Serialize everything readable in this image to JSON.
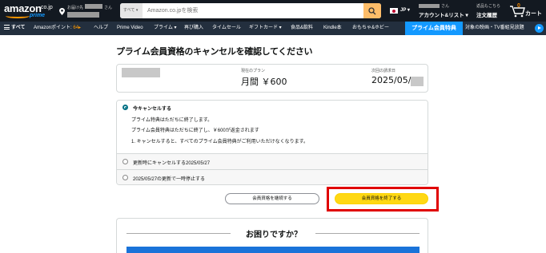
{
  "header": {
    "logo_text": "amazon",
    "logo_tld": ".co.jp",
    "logo_prime": "prime",
    "deliver_label": "お届け先",
    "deliver_suffix": "さん",
    "search": {
      "category": "すべて ▾",
      "placeholder": "Amazon.co.jpを検索"
    },
    "language": "JP ▾",
    "account_suffix": "さん",
    "account_label": "アカウント&リスト ▾",
    "orders_line1": "返品もこちら",
    "orders_line2": "注文履歴",
    "cart_count": "0",
    "cart_label": "カート"
  },
  "nav": {
    "all": "すべて",
    "points_label": "Amazonポイント:",
    "points_value": "64",
    "points_arrow": "▸",
    "items": [
      "ヘルプ",
      "Prime Video",
      "プライム ▾",
      "再び購入",
      "タイムセール",
      "ギフトカード ▾",
      "食品&飲料",
      "Kindle本",
      "おもちゃ&ホビー"
    ],
    "prime_banner": "プライム会員特典",
    "promo": "対象の映画・TV番組見放題"
  },
  "main": {
    "title": "プライム会員資格のキャンセルを確認してください",
    "plan": {
      "current_label": "現在のプラン",
      "current_value": "月間 ￥600",
      "next_label": "次回の請求日",
      "next_value": "2025/05/"
    },
    "options": [
      {
        "title": "今キャンセルする",
        "selected": true,
        "lines": [
          "プライム特典はただちに終了します。",
          "プライム会員特典はただちに終了し、￥600が返金されます",
          "1. キャンセルすると、すべてのプライム会員特典がご利用いただけなくなります。"
        ]
      },
      {
        "title": "更新時にキャンセルする2025/05/27",
        "selected": false
      },
      {
        "title": "2025/05/27の更新で一時停止する",
        "selected": false
      }
    ],
    "keep_button": "会員資格を継続する",
    "end_button": "会員資格を終了する",
    "help_title": "お困りですか？"
  },
  "colors": {
    "header_bg": "#131921",
    "nav_bg": "#232f3e",
    "prime_blue": "#1399ff",
    "search_button": "#febd69",
    "end_button": "#ffd814",
    "highlight": "#e00000",
    "radio_checked": "#007185"
  },
  "icons": [
    "location-pin-icon",
    "search-icon",
    "cart-icon",
    "hamburger-menu-icon",
    "play-icon",
    "japan-flag-icon"
  ]
}
